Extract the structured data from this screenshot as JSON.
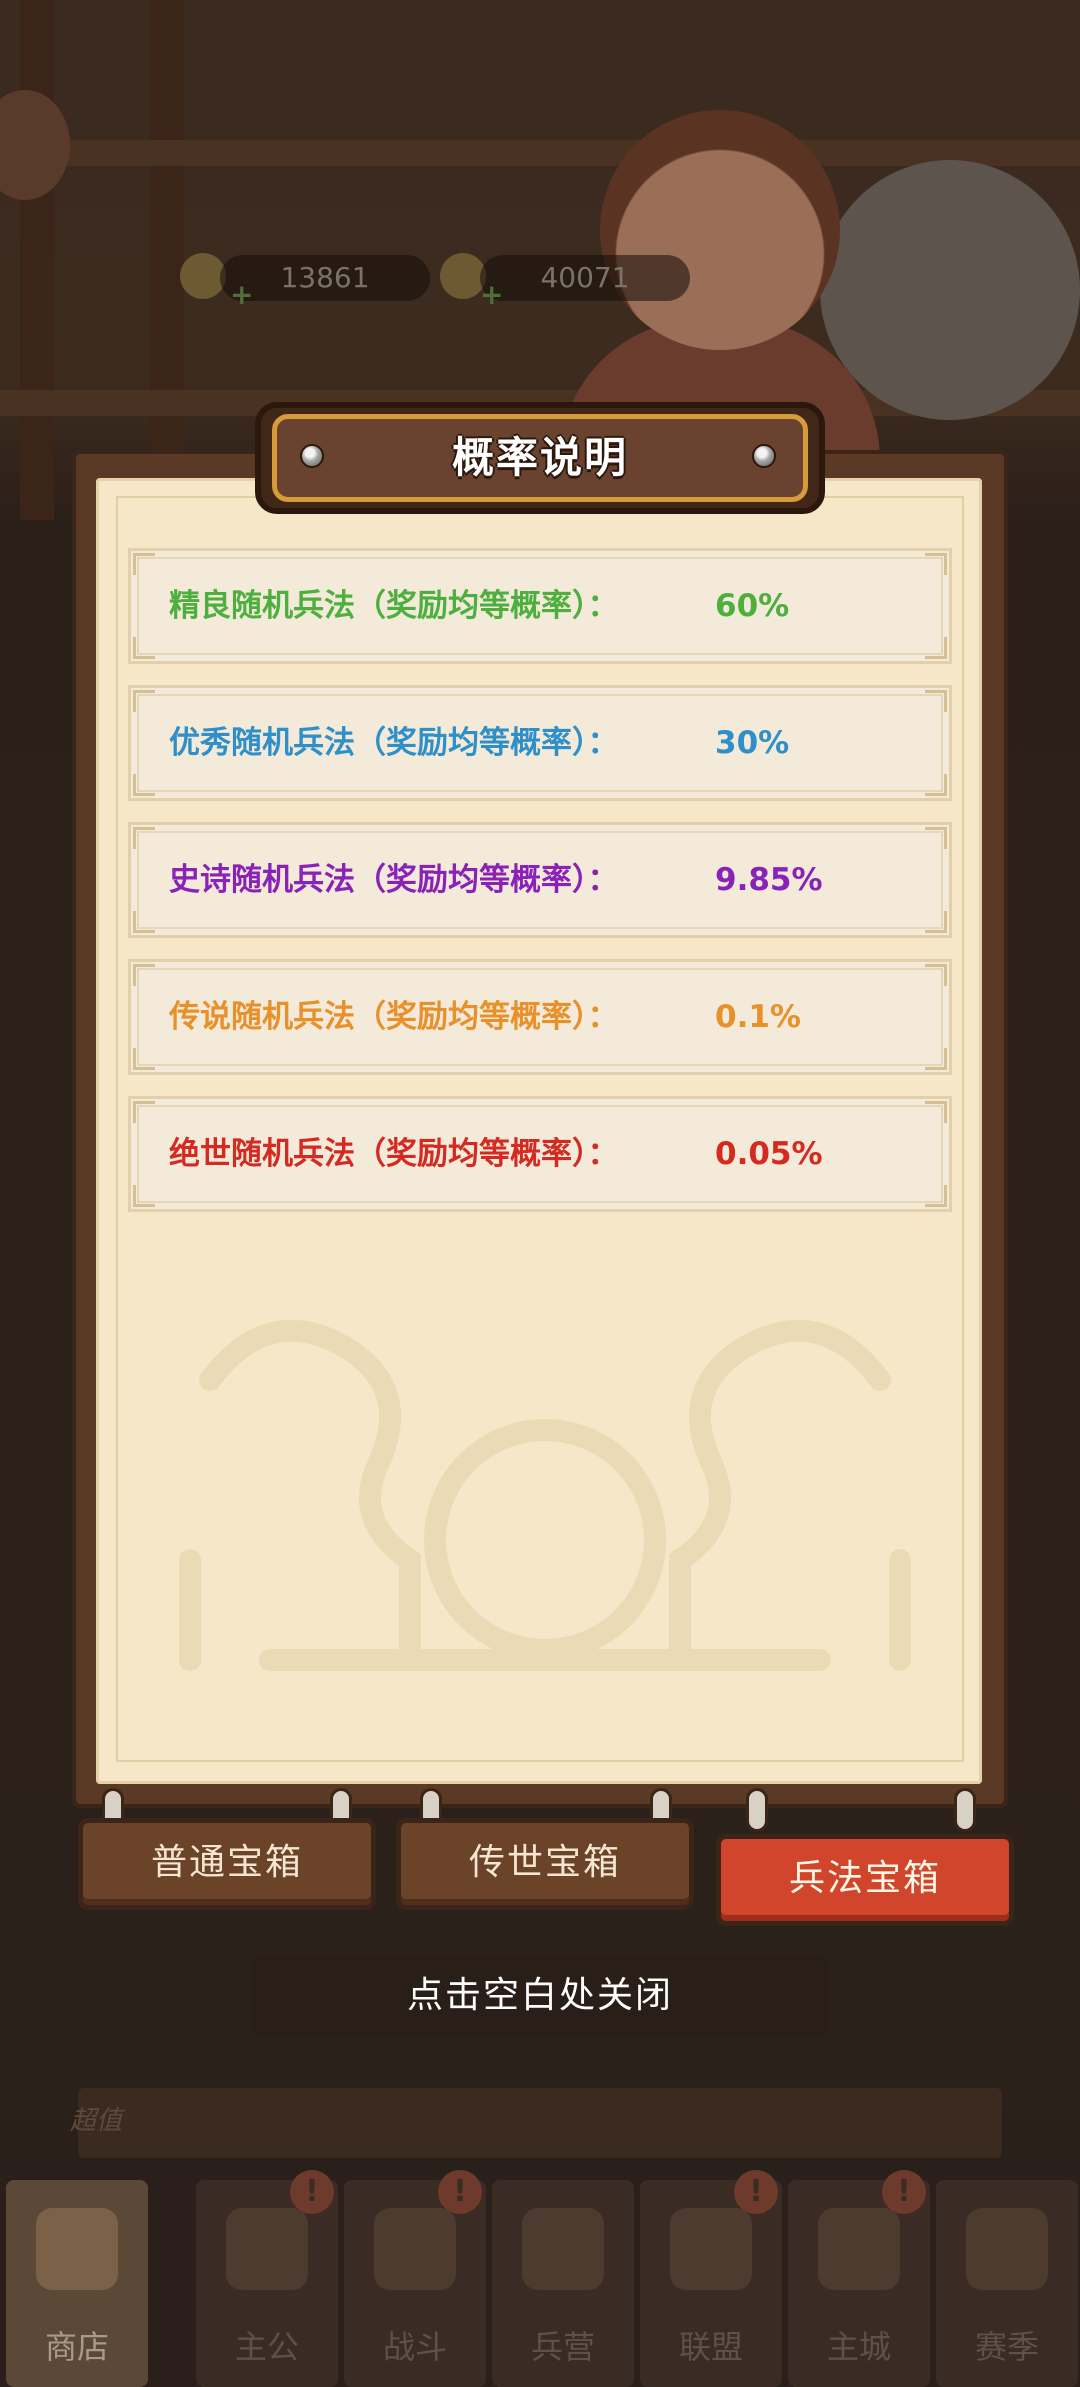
{
  "resources": {
    "copper": "13861",
    "gold": "40071"
  },
  "modal": {
    "title": "概率说明",
    "rows": [
      {
        "label": "精良随机兵法（奖励均等概率）：",
        "value": "60%",
        "color": "#4caf3e"
      },
      {
        "label": "优秀随机兵法（奖励均等概率）：",
        "value": "30%",
        "color": "#2f8fc8"
      },
      {
        "label": "史诗随机兵法（奖励均等概率）：",
        "value": "9.85%",
        "color": "#8b22b8"
      },
      {
        "label": "传说随机兵法（奖励均等概率）：",
        "value": "0.1%",
        "color": "#e8902a"
      },
      {
        "label": "绝世随机兵法（奖励均等概率）：",
        "value": "0.05%",
        "color": "#d42a22"
      }
    ]
  },
  "tabs": [
    {
      "label": "普通宝箱",
      "active": false
    },
    {
      "label": "传世宝箱",
      "active": false
    },
    {
      "label": "兵法宝箱",
      "active": true
    }
  ],
  "close_hint": "点击空白处关闭",
  "promo": {
    "tag": "超值"
  },
  "bottom_nav": [
    {
      "label": "商店",
      "icon": "shop-icon",
      "active": true
    },
    {
      "label": "主公",
      "icon": "lord-icon",
      "alert": true
    },
    {
      "label": "战斗",
      "icon": "battle-icon",
      "alert": true
    },
    {
      "label": "兵营",
      "icon": "barracks-icon",
      "alert": false
    },
    {
      "label": "联盟",
      "icon": "alliance-icon",
      "alert": true
    },
    {
      "label": "主城",
      "icon": "city-icon",
      "alert": true
    },
    {
      "label": "赛季",
      "icon": "season-icon",
      "alert": false
    }
  ]
}
